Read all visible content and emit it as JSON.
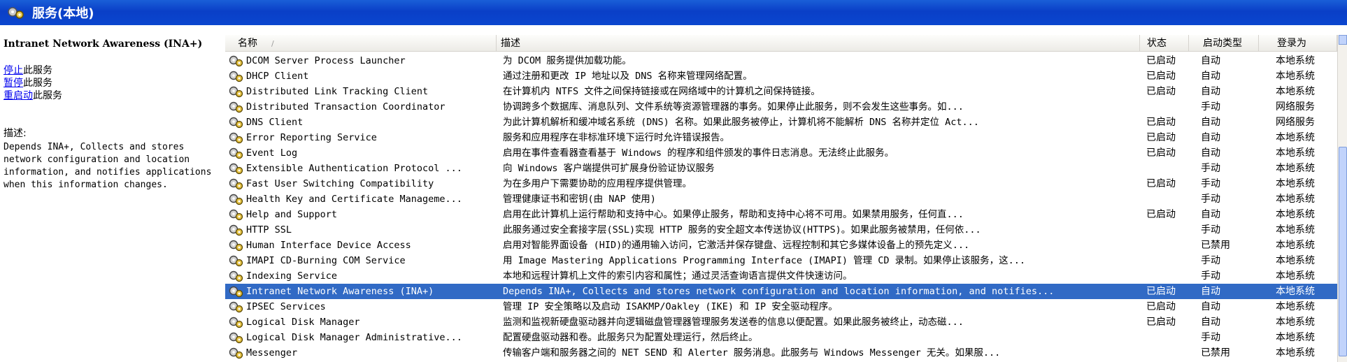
{
  "window": {
    "title": "服务(本地)",
    "icon": "services-gear-icon"
  },
  "left_pane": {
    "service_name": "Intranet Network Awareness (INA+)",
    "actions": [
      {
        "link": "停止",
        "suffix": "此服务"
      },
      {
        "link": "暂停",
        "suffix": "此服务"
      },
      {
        "link": "重启动",
        "suffix": "此服务"
      }
    ],
    "description_label": "描述:",
    "description": "Depends INA+, Collects and stores network configuration and location information, and notifies applications when this information changes."
  },
  "columns": {
    "name": "名称",
    "sort_indicator": "/",
    "description": "描述",
    "status": "状态",
    "startup": "启动类型",
    "logon": "登录为"
  },
  "rows": [
    {
      "name": "DCOM Server Process Launcher",
      "desc": "为 DCOM 服务提供加载功能。",
      "status": "已启动",
      "startup": "自动",
      "logon": "本地系统"
    },
    {
      "name": "DHCP Client",
      "desc": "通过注册和更改 IP 地址以及 DNS 名称来管理网络配置。",
      "status": "已启动",
      "startup": "自动",
      "logon": "本地系统"
    },
    {
      "name": "Distributed Link Tracking Client",
      "desc": "在计算机内 NTFS 文件之间保持链接或在网络域中的计算机之间保持链接。",
      "status": "已启动",
      "startup": "自动",
      "logon": "本地系统"
    },
    {
      "name": "Distributed Transaction Coordinator",
      "desc": "协调跨多个数据库、消息队列、文件系统等资源管理器的事务。如果停止此服务，则不会发生这些事务。如...",
      "status": "",
      "startup": "手动",
      "logon": "网络服务"
    },
    {
      "name": "DNS Client",
      "desc": "为此计算机解析和缓冲域名系统 (DNS) 名称。如果此服务被停止，计算机将不能解析 DNS 名称并定位 Act...",
      "status": "已启动",
      "startup": "自动",
      "logon": "网络服务"
    },
    {
      "name": "Error Reporting Service",
      "desc": "服务和应用程序在非标准环境下运行时允许错误报告。",
      "status": "已启动",
      "startup": "自动",
      "logon": "本地系统"
    },
    {
      "name": "Event Log",
      "desc": "启用在事件查看器查看基于 Windows 的程序和组件颁发的事件日志消息。无法终止此服务。",
      "status": "已启动",
      "startup": "自动",
      "logon": "本地系统"
    },
    {
      "name": "Extensible Authentication Protocol ...",
      "desc": "向 Windows 客户端提供可扩展身份验证协议服务",
      "status": "",
      "startup": "手动",
      "logon": "本地系统"
    },
    {
      "name": "Fast User Switching Compatibility",
      "desc": "为在多用户下需要协助的应用程序提供管理。",
      "status": "已启动",
      "startup": "手动",
      "logon": "本地系统"
    },
    {
      "name": "Health Key and Certificate Manageme...",
      "desc": "管理健康证书和密钥(由 NAP 使用)",
      "status": "",
      "startup": "手动",
      "logon": "本地系统"
    },
    {
      "name": "Help and Support",
      "desc": "启用在此计算机上运行帮助和支持中心。如果停止服务，帮助和支持中心将不可用。如果禁用服务，任何直...",
      "status": "已启动",
      "startup": "自动",
      "logon": "本地系统"
    },
    {
      "name": "HTTP SSL",
      "desc": "此服务通过安全套接字层(SSL)实现 HTTP 服务的安全超文本传送协议(HTTPS)。如果此服务被禁用，任何依...",
      "status": "",
      "startup": "手动",
      "logon": "本地系统"
    },
    {
      "name": "Human Interface Device Access",
      "desc": "启用对智能界面设备 (HID)的通用输入访问，它激活并保存键盘、远程控制和其它多媒体设备上的预先定义...",
      "status": "",
      "startup": "已禁用",
      "logon": "本地系统"
    },
    {
      "name": "IMAPI CD-Burning COM Service",
      "desc": "用 Image Mastering Applications Programming Interface (IMAPI) 管理 CD 录制。如果停止该服务，这...",
      "status": "",
      "startup": "手动",
      "logon": "本地系统"
    },
    {
      "name": "Indexing Service",
      "desc": "本地和远程计算机上文件的索引内容和属性；通过灵活查询语言提供文件快速访问。",
      "status": "",
      "startup": "手动",
      "logon": "本地系统"
    },
    {
      "name": "Intranet Network Awareness (INA+)",
      "desc": "Depends INA+, Collects and stores network configuration and location information, and notifies...",
      "status": "已启动",
      "startup": "自动",
      "logon": "本地系统",
      "selected": true
    },
    {
      "name": "IPSEC Services",
      "desc": "管理 IP 安全策略以及启动 ISAKMP/Oakley (IKE) 和 IP 安全驱动程序。",
      "status": "已启动",
      "startup": "自动",
      "logon": "本地系统"
    },
    {
      "name": "Logical Disk Manager",
      "desc": "监测和监视新硬盘驱动器并向逻辑磁盘管理器管理服务发送卷的信息以便配置。如果此服务被终止，动态磁...",
      "status": "已启动",
      "startup": "自动",
      "logon": "本地系统"
    },
    {
      "name": "Logical Disk Manager Administrative...",
      "desc": "配置硬盘驱动器和卷。此服务只为配置处理运行，然后终止。",
      "status": "",
      "startup": "手动",
      "logon": "本地系统"
    },
    {
      "name": "Messenger",
      "desc": "传输客户端和服务器之间的 NET SEND 和 Alerter 服务消息。此服务与 Windows Messenger 无关。如果服...",
      "status": "",
      "startup": "已禁用",
      "logon": "本地系统"
    }
  ],
  "colors": {
    "titlebar": "#0a3fc7",
    "selection": "#316ac5",
    "link": "#0000ee"
  }
}
